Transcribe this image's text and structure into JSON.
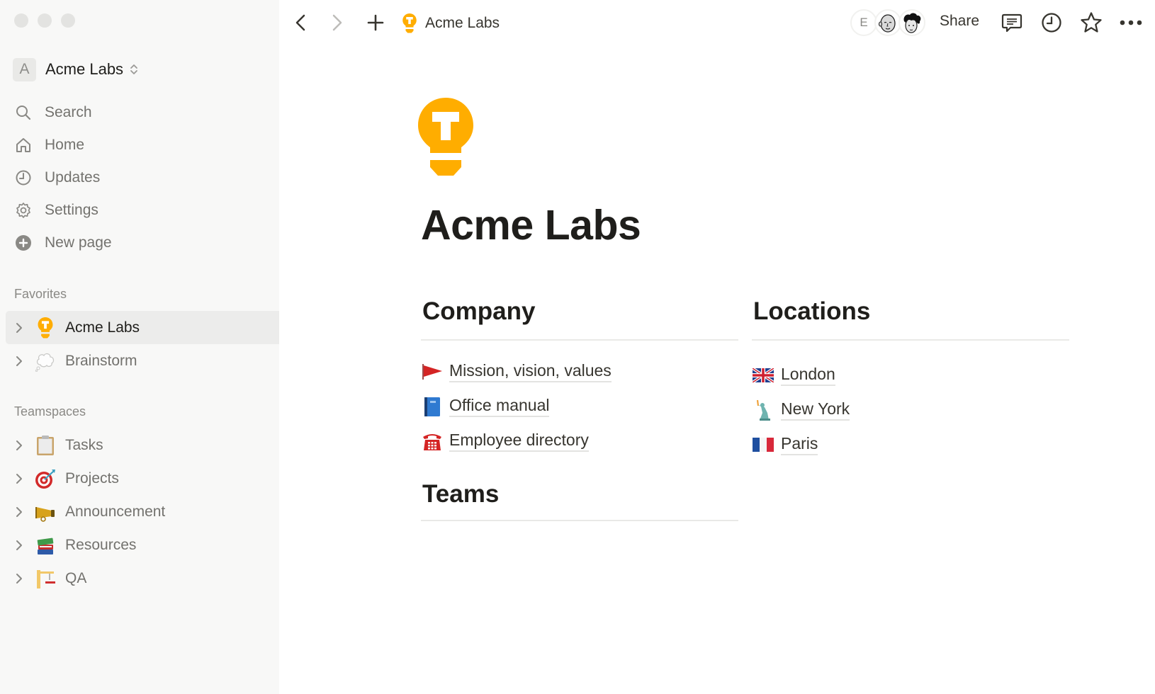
{
  "window": {
    "traffic_lights": [
      "close",
      "minimize",
      "maximize"
    ]
  },
  "sidebar": {
    "workspace": {
      "avatar_letter": "A",
      "name": "Acme Labs",
      "switcher_icon": "chevron-up-down-icon"
    },
    "nav": [
      {
        "label": "Search",
        "icon": "search-icon"
      },
      {
        "label": "Home",
        "icon": "home-icon"
      },
      {
        "label": "Updates",
        "icon": "clock-icon"
      },
      {
        "label": "Settings",
        "icon": "gear-icon"
      },
      {
        "label": "New page",
        "icon": "plus-circle-icon"
      }
    ],
    "favorites": {
      "label": "Favorites",
      "items": [
        {
          "label": "Acme Labs",
          "icon": "lightbulb-icon",
          "active": true
        },
        {
          "label": "Brainstorm",
          "icon": "thought-bubble-icon",
          "active": false
        }
      ]
    },
    "teamspaces": {
      "label": "Teamspaces",
      "items": [
        {
          "label": "Tasks",
          "icon": "clipboard-icon"
        },
        {
          "label": "Projects",
          "icon": "target-dart-icon"
        },
        {
          "label": "Announcement",
          "icon": "megaphone-icon"
        },
        {
          "label": "Resources",
          "icon": "books-icon"
        },
        {
          "label": "QA",
          "icon": "crane-icon"
        }
      ]
    }
  },
  "topbar": {
    "back_icon": "chevron-left-icon",
    "forward_icon": "chevron-right-icon",
    "new_icon": "plus-icon",
    "breadcrumb": {
      "label": "Acme Labs",
      "icon": "lightbulb-icon"
    },
    "avatars": [
      {
        "type": "letter",
        "value": "E"
      },
      {
        "type": "illustration",
        "value": "bald-face-avatar"
      },
      {
        "type": "illustration",
        "value": "curly-hair-avatar"
      }
    ],
    "share_label": "Share",
    "actions": [
      "comment-icon",
      "clock-icon",
      "star-icon",
      "more-icon"
    ]
  },
  "page": {
    "icon": "lightbulb-icon",
    "title": "Acme Labs",
    "accent_color": "#ffad00",
    "sections": {
      "company": {
        "heading": "Company",
        "links": [
          {
            "label": "Mission, vision, values",
            "icon": "red-flag-icon"
          },
          {
            "label": "Office manual",
            "icon": "blue-book-icon"
          },
          {
            "label": "Employee directory",
            "icon": "telephone-icon"
          }
        ]
      },
      "locations": {
        "heading": "Locations",
        "links": [
          {
            "label": "London",
            "icon": "uk-flag-icon"
          },
          {
            "label": "New York",
            "icon": "statue-of-liberty-icon"
          },
          {
            "label": "Paris",
            "icon": "france-flag-icon"
          }
        ]
      },
      "teams": {
        "heading": "Teams"
      }
    }
  }
}
